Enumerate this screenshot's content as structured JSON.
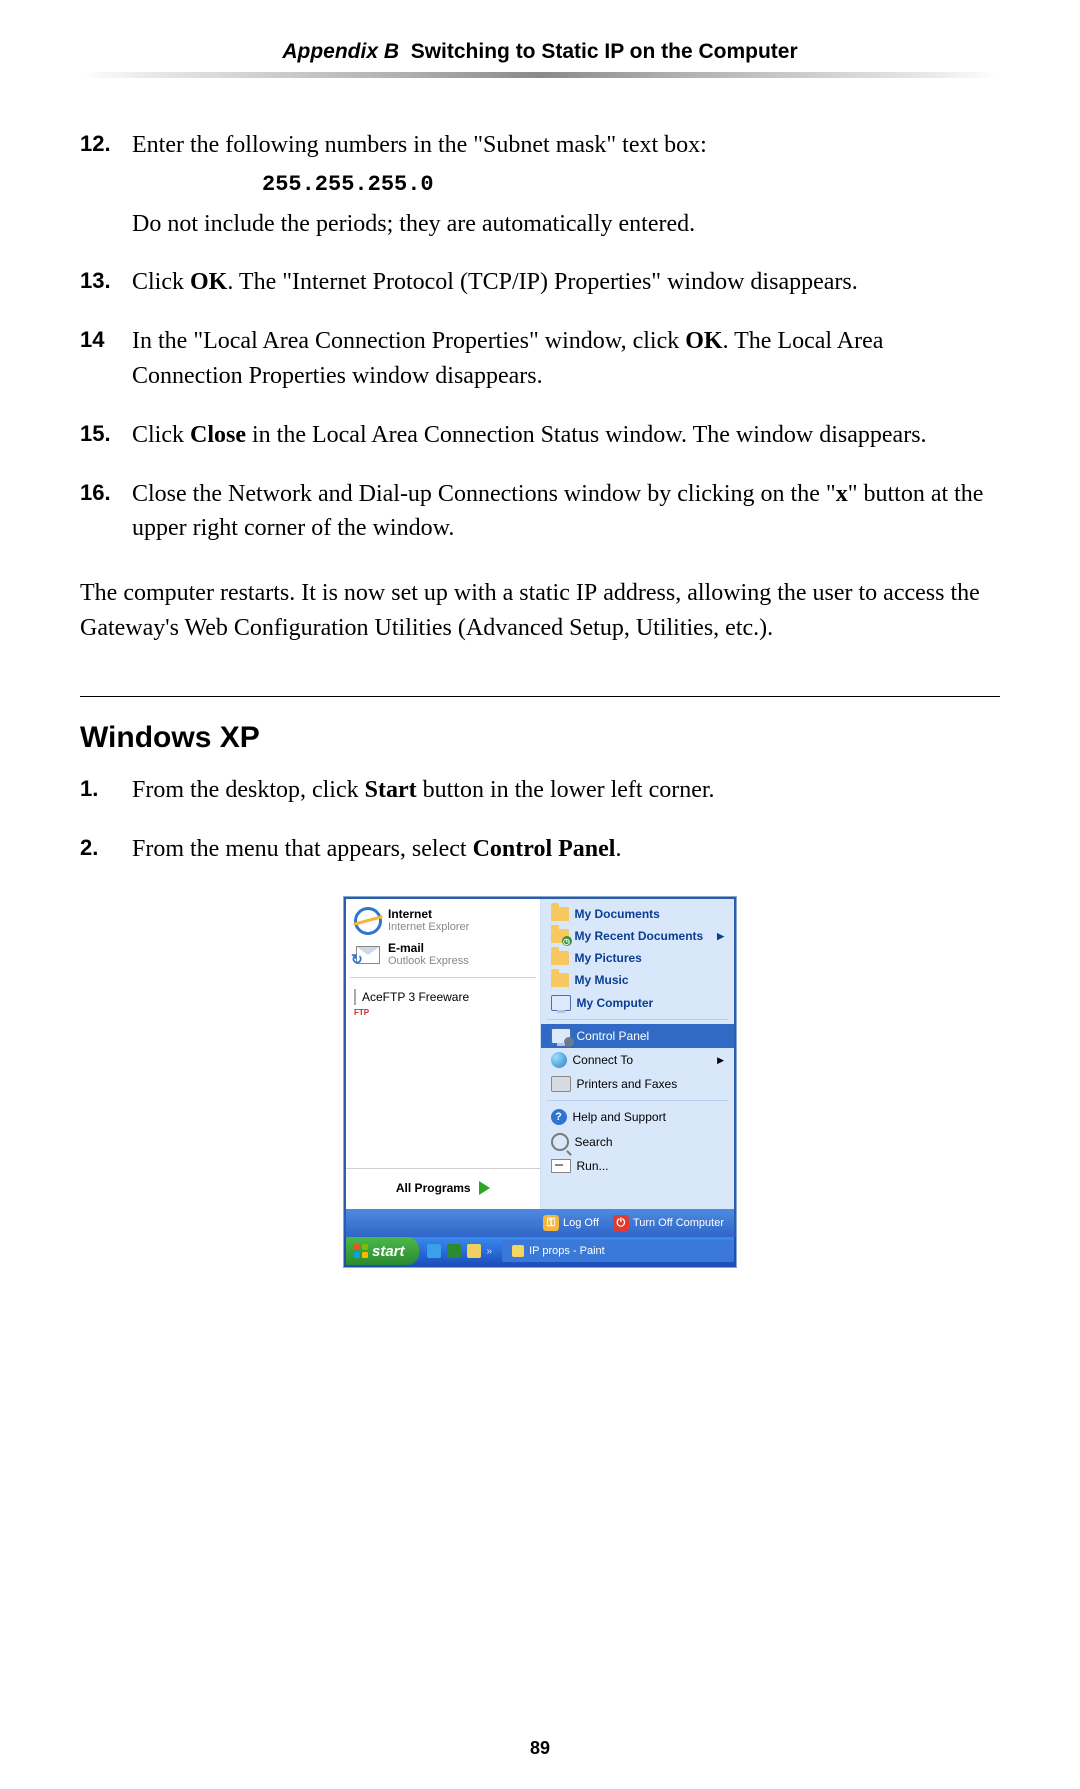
{
  "header": {
    "appendix": "Appendix B",
    "title": "Switching to Static IP on the Computer"
  },
  "steps_a": [
    {
      "n": "12.",
      "pre": "Enter the following numbers in the \"Subnet mask\" text box:",
      "code": "255.255.255.0",
      "post": "Do not include the periods; they are automatically entered."
    },
    {
      "n": "13.",
      "html_parts": [
        "Click ",
        "OK",
        ". The \"Internet Protocol (",
        "TCP/IP",
        ") Properties\" window disappears."
      ]
    },
    {
      "n": "14",
      "html_parts": [
        "In the \"Local Area Connection Properties\" window, click ",
        "OK",
        ". The Local Area Connection Properties window disappears."
      ]
    },
    {
      "n": "15.",
      "html_parts": [
        "Click ",
        "Close",
        " in the Local Area Connection Status window. The window disappears."
      ]
    },
    {
      "n": "16.",
      "html_parts": [
        "Close the Network and Dial-up Connections window by clicking on the \"",
        "x",
        "\" button at the upper right corner of the window."
      ]
    }
  ],
  "paragraph": [
    "The computer restarts. It is now set up with a static ",
    "IP",
    " address, allowing the user to access the Gateway's Web Configuration Utilities (Advanced Setup, Utilities, etc.)."
  ],
  "section": "Windows XP",
  "steps_b": [
    {
      "n": "1.",
      "parts": [
        "From the desktop, click ",
        "Start",
        " button in the lower left corner."
      ]
    },
    {
      "n": "2.",
      "parts": [
        "From the menu that appears, select ",
        "Control Panel",
        "."
      ]
    }
  ],
  "startmenu": {
    "left_pinned": [
      {
        "title": "Internet",
        "sub": "Internet Explorer",
        "icon": "ie"
      },
      {
        "title": "E-mail",
        "sub": "Outlook Express",
        "icon": "mail"
      }
    ],
    "left_recent": [
      {
        "title": "AceFTP 3 Freeware",
        "icon": "ftp"
      }
    ],
    "all_programs": "All Programs",
    "right": [
      {
        "label": "My Documents",
        "icon": "folder"
      },
      {
        "label": "My Recent Documents",
        "icon": "folder-clock",
        "submenu": true
      },
      {
        "label": "My Pictures",
        "icon": "folder-pic"
      },
      {
        "label": "My Music",
        "icon": "folder-music"
      },
      {
        "label": "My Computer",
        "icon": "monitor"
      }
    ],
    "right2": [
      {
        "label": "Control Panel",
        "icon": "monitor-gear",
        "selected": true
      },
      {
        "label": "Connect To",
        "icon": "globe",
        "submenu": true
      },
      {
        "label": "Printers and Faxes",
        "icon": "printer"
      }
    ],
    "right3": [
      {
        "label": "Help and Support",
        "icon": "help"
      },
      {
        "label": "Search",
        "icon": "search"
      },
      {
        "label": "Run...",
        "icon": "run"
      }
    ],
    "logoff": "Log Off",
    "shutdown": "Turn Off Computer",
    "start": "start",
    "task": "IP props - Paint"
  },
  "page_number": "89"
}
